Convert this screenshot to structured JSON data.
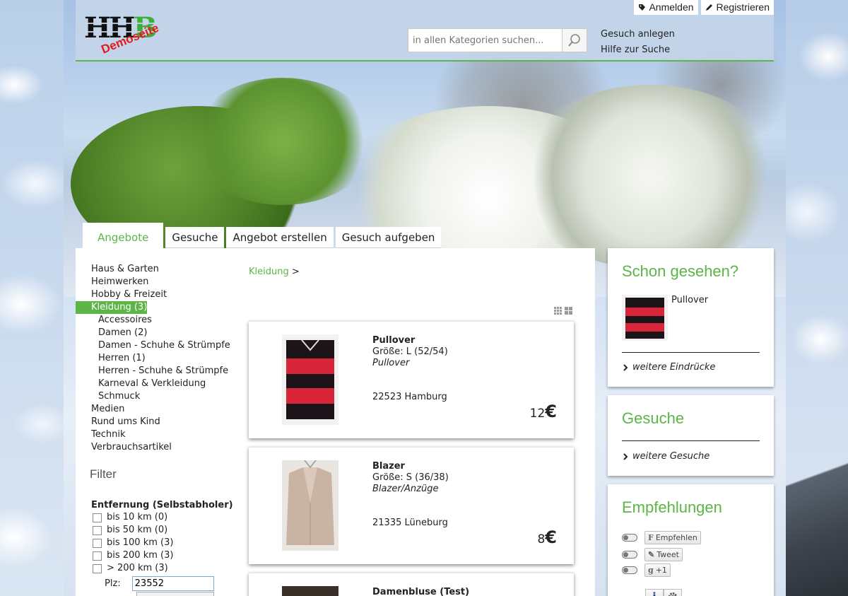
{
  "header": {
    "logo_letters_1": "HH",
    "logo_letters_2": "B",
    "logo_stamp": "Demoseite",
    "login_label": "Anmelden",
    "register_label": "Registrieren",
    "search_placeholder": "in allen Kategorien suchen...",
    "links": [
      "Gesuch anlegen",
      "Hilfe zur Suche"
    ]
  },
  "tabs": [
    {
      "label": "Angebote",
      "active": true
    },
    {
      "label": "Gesuche"
    },
    {
      "label": "Angebot erstellen"
    },
    {
      "label": "Gesuch aufgeben"
    }
  ],
  "categories": [
    {
      "label": "Haus & Garten"
    },
    {
      "label": "Heimwerken"
    },
    {
      "label": "Hobby & Freizeit"
    },
    {
      "label": "Kleidung (3)",
      "active": true
    },
    {
      "label": "Accessoires",
      "sub": true
    },
    {
      "label": "Damen (2)",
      "sub": true
    },
    {
      "label": "Damen - Schuhe & Strümpfe",
      "sub": true
    },
    {
      "label": "Herren (1)",
      "sub": true
    },
    {
      "label": "Herren - Schuhe & Strümpfe",
      "sub": true
    },
    {
      "label": "Karneval & Verkleidung",
      "sub": true
    },
    {
      "label": "Schmuck",
      "sub": true
    },
    {
      "label": "Medien"
    },
    {
      "label": "Rund ums Kind"
    },
    {
      "label": "Technik"
    },
    {
      "label": "Verbrauchsartikel"
    }
  ],
  "filter": {
    "title": "Filter",
    "distance_title": "Entfernung (Selbstabholer)",
    "options": [
      "bis 10 km (0)",
      "bis 50 km (0)",
      "bis 100 km (3)",
      "bis 200 km (3)",
      "> 200 km (3)"
    ],
    "plz_label": "Plz:",
    "plz_value": "23552"
  },
  "breadcrumb": {
    "link": "Kleidung",
    "sep": ">"
  },
  "products": [
    {
      "title": "Pullover",
      "size": "Größe: L (52/54)",
      "category": "Pullover",
      "location": "22523 Hamburg",
      "price": "12",
      "currency": "€"
    },
    {
      "title": "Blazer",
      "size": "Größe: S (36/38)",
      "category": "Blazer/Anzüge",
      "location": "21335 Lüneburg",
      "price": "8",
      "currency": "€"
    },
    {
      "title": "Damenbluse (Test)"
    }
  ],
  "sidebar": {
    "seen": {
      "title": "Schon gesehen?",
      "item": "Pullover",
      "more": "weitere Eindrücke"
    },
    "wanted": {
      "title": "Gesuche",
      "more": "weitere Gesuche"
    },
    "recommend": {
      "title": "Empfehlungen",
      "facebook": "Empfehlen",
      "tweet": "Tweet",
      "gplus": "+1",
      "info": "i"
    }
  },
  "colors": {
    "accent": "#5cb546",
    "price_red": "#e21a1a"
  }
}
